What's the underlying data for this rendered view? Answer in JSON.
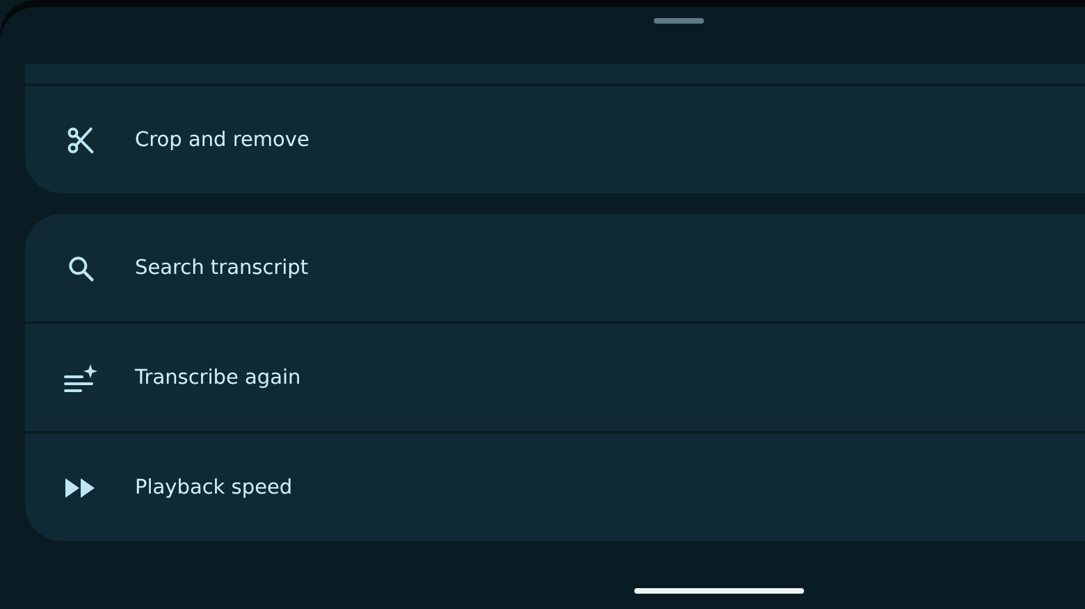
{
  "groups": [
    {
      "items": [
        {
          "label": "Crop and remove",
          "kind": "scissors"
        }
      ]
    },
    {
      "items": [
        {
          "label": "Search transcript",
          "kind": "search"
        },
        {
          "label": "Transcribe again",
          "kind": "transcribe"
        },
        {
          "label": "Playback speed",
          "kind": "speed"
        }
      ]
    }
  ]
}
